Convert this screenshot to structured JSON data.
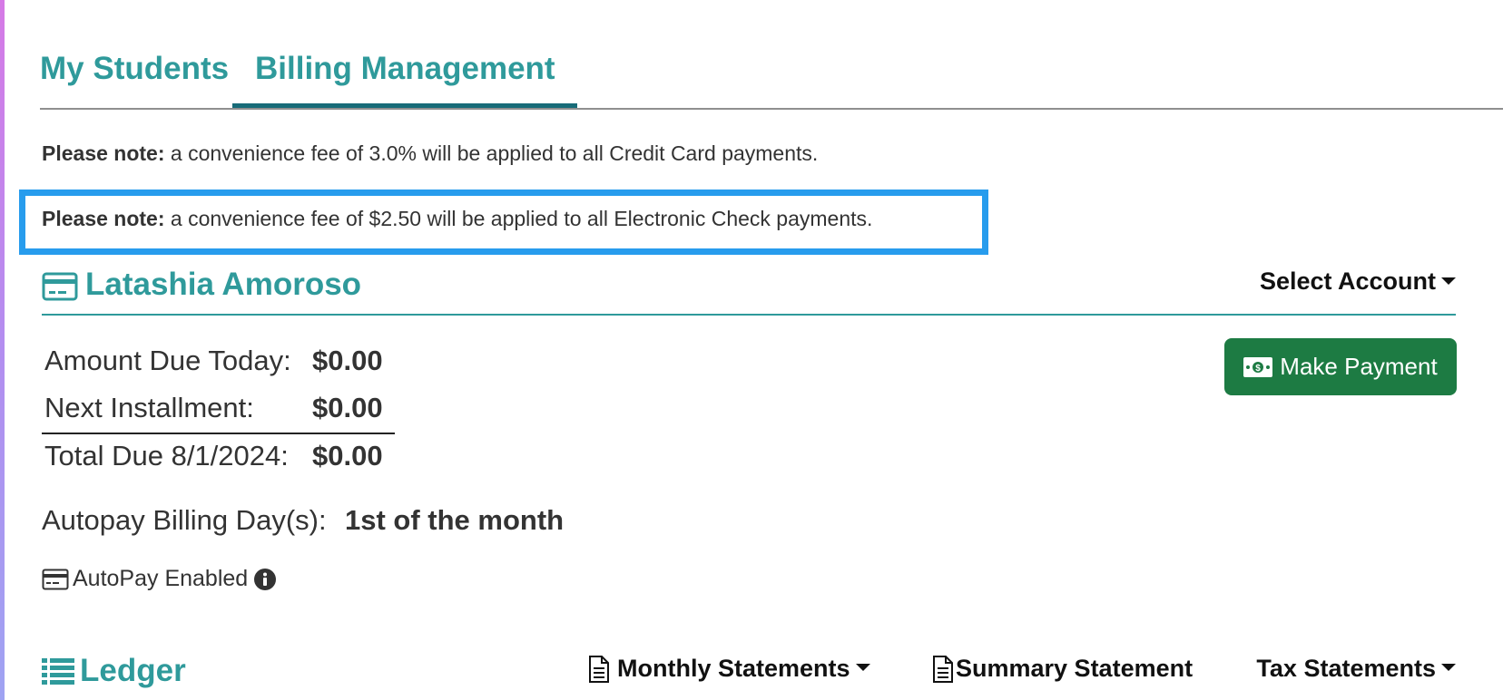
{
  "tabs": [
    {
      "label": "My Students",
      "active": false
    },
    {
      "label": "Billing Management",
      "active": true
    }
  ],
  "notes": [
    {
      "prefix": "Please note:",
      "text": " a convenience fee of 3.0% will be applied to all Credit Card payments."
    },
    {
      "prefix": "Please note:",
      "text": " a convenience fee of $2.50 will be applied to all Electronic Check payments."
    }
  ],
  "account": {
    "icon": "credit-card-icon",
    "name": "Latashia Amoroso",
    "select_label": "Select Account"
  },
  "amounts": [
    {
      "label": "Amount Due Today:",
      "value": "$0.00"
    },
    {
      "label": "Next Installment:",
      "value": "$0.00"
    },
    {
      "label": "Total Due 8/1/2024:",
      "value": "$0.00"
    }
  ],
  "payment_button": {
    "icon": "money-bill-icon",
    "label": "Make Payment"
  },
  "autopay": {
    "label": "Autopay Billing Day(s):",
    "value": "1st of the month",
    "status_icon": "credit-card-icon",
    "status_text": "AutoPay Enabled",
    "info_icon": "info-circle-icon"
  },
  "ledger": {
    "icon": "list-icon",
    "title": "Ledger",
    "links": [
      {
        "icon": "document-icon",
        "label": "Monthly Statements",
        "dropdown": true
      },
      {
        "icon": "document-icon",
        "label": "Summary Statement",
        "dropdown": false
      },
      {
        "label": "Tax Statements",
        "dropdown": true
      }
    ]
  },
  "colors": {
    "teal": "#2f9a9b",
    "tab_underline": "#176b78",
    "highlight": "#279ced",
    "button_green": "#1d7b43"
  }
}
